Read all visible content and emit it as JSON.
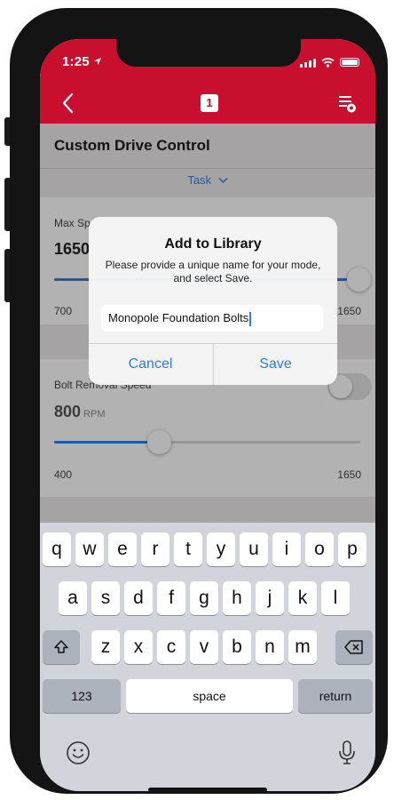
{
  "status_bar": {
    "time": "1:25"
  },
  "nav": {
    "tab_count": "1"
  },
  "page": {
    "title": "Custom Drive Control",
    "task_label": "Task",
    "max_speed": {
      "label": "Max Sp",
      "value": "1650",
      "min": "700",
      "max": "1650",
      "level": 1.0
    },
    "bolt_removal": {
      "label": "Bolt Removal Speed",
      "value": "800",
      "unit": "RPM",
      "min": "400",
      "max": "1650",
      "level": 0.32
    }
  },
  "dialog": {
    "title": "Add to Library",
    "message": "Please provide a unique name for your mode, and select Save.",
    "input_value": "Monopole Foundation Bolts",
    "cancel_label": "Cancel",
    "save_label": "Save"
  },
  "keyboard": {
    "row1": [
      "q",
      "w",
      "e",
      "r",
      "t",
      "y",
      "u",
      "i",
      "o",
      "p"
    ],
    "row2": [
      "a",
      "s",
      "d",
      "f",
      "g",
      "h",
      "j",
      "k",
      "l"
    ],
    "row3": [
      "z",
      "x",
      "c",
      "v",
      "b",
      "n",
      "m"
    ],
    "numbers_label": "123",
    "space_label": "space",
    "return_label": "return",
    "icons": {
      "shift": "shift-icon",
      "delete": "delete-icon",
      "emoji": "emoji-icon",
      "mic": "microphone-icon"
    }
  },
  "colors": {
    "brand_red": "#c8102e",
    "accent_blue": "#2f7de1"
  }
}
